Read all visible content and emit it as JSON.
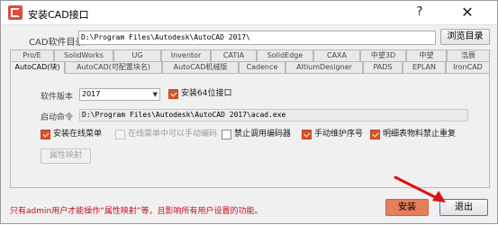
{
  "window": {
    "title": "安装CAD接口",
    "help_glyph": "?",
    "close_glyph": "✕"
  },
  "path": {
    "label": "CAD软件目录",
    "value": "D:\\Program Files\\Autodesk\\AutoCAD 2017\\",
    "browse_label": "浏览目录"
  },
  "tabs_row1": [
    "Pro/E",
    "SolidWorks",
    "UG",
    "Inventor",
    "CATIA",
    "SolidEdge",
    "CAXA",
    "中望3D",
    "中望",
    "浩辰"
  ],
  "tabs_row2": [
    "AutoCAD(块)",
    "AutoCAD(可配置块名)",
    "AutoCAD机械版",
    "Cadence",
    "AltiumDesigner",
    "PADS",
    "EPLAN",
    "IronCAD"
  ],
  "active_tab": "AutoCAD(块)",
  "settings": {
    "version_label": "软件版本",
    "version_value": "2017",
    "install64_label": "安装64位接口",
    "install64_checked": true,
    "command_label": "启动命令",
    "command_value": "D:\\Program Files\\Autodesk\\AutoCAD 2017\\acad.exe"
  },
  "options": [
    {
      "label": "安装在线菜单",
      "checked": true,
      "enabled": true
    },
    {
      "label": "在线菜单中可以手动编码",
      "checked": false,
      "enabled": false
    },
    {
      "label": "禁止调用编码器",
      "checked": false,
      "enabled": true
    },
    {
      "label": "手动维护序号",
      "checked": true,
      "enabled": true
    },
    {
      "label": "明细表物料禁止重复",
      "checked": true,
      "enabled": true
    }
  ],
  "attr_mapping_label": "属性映射",
  "footer": {
    "note": "只有admin用户才能操作“属性映射”等，且影响所有用户设置的功能。",
    "install_label": "安装",
    "exit_label": "退出"
  },
  "colors": {
    "accent_orange": "#d9532a",
    "install_button": "#e57f5a",
    "note_red": "#c0121d",
    "annotation_red": "#e01010"
  }
}
